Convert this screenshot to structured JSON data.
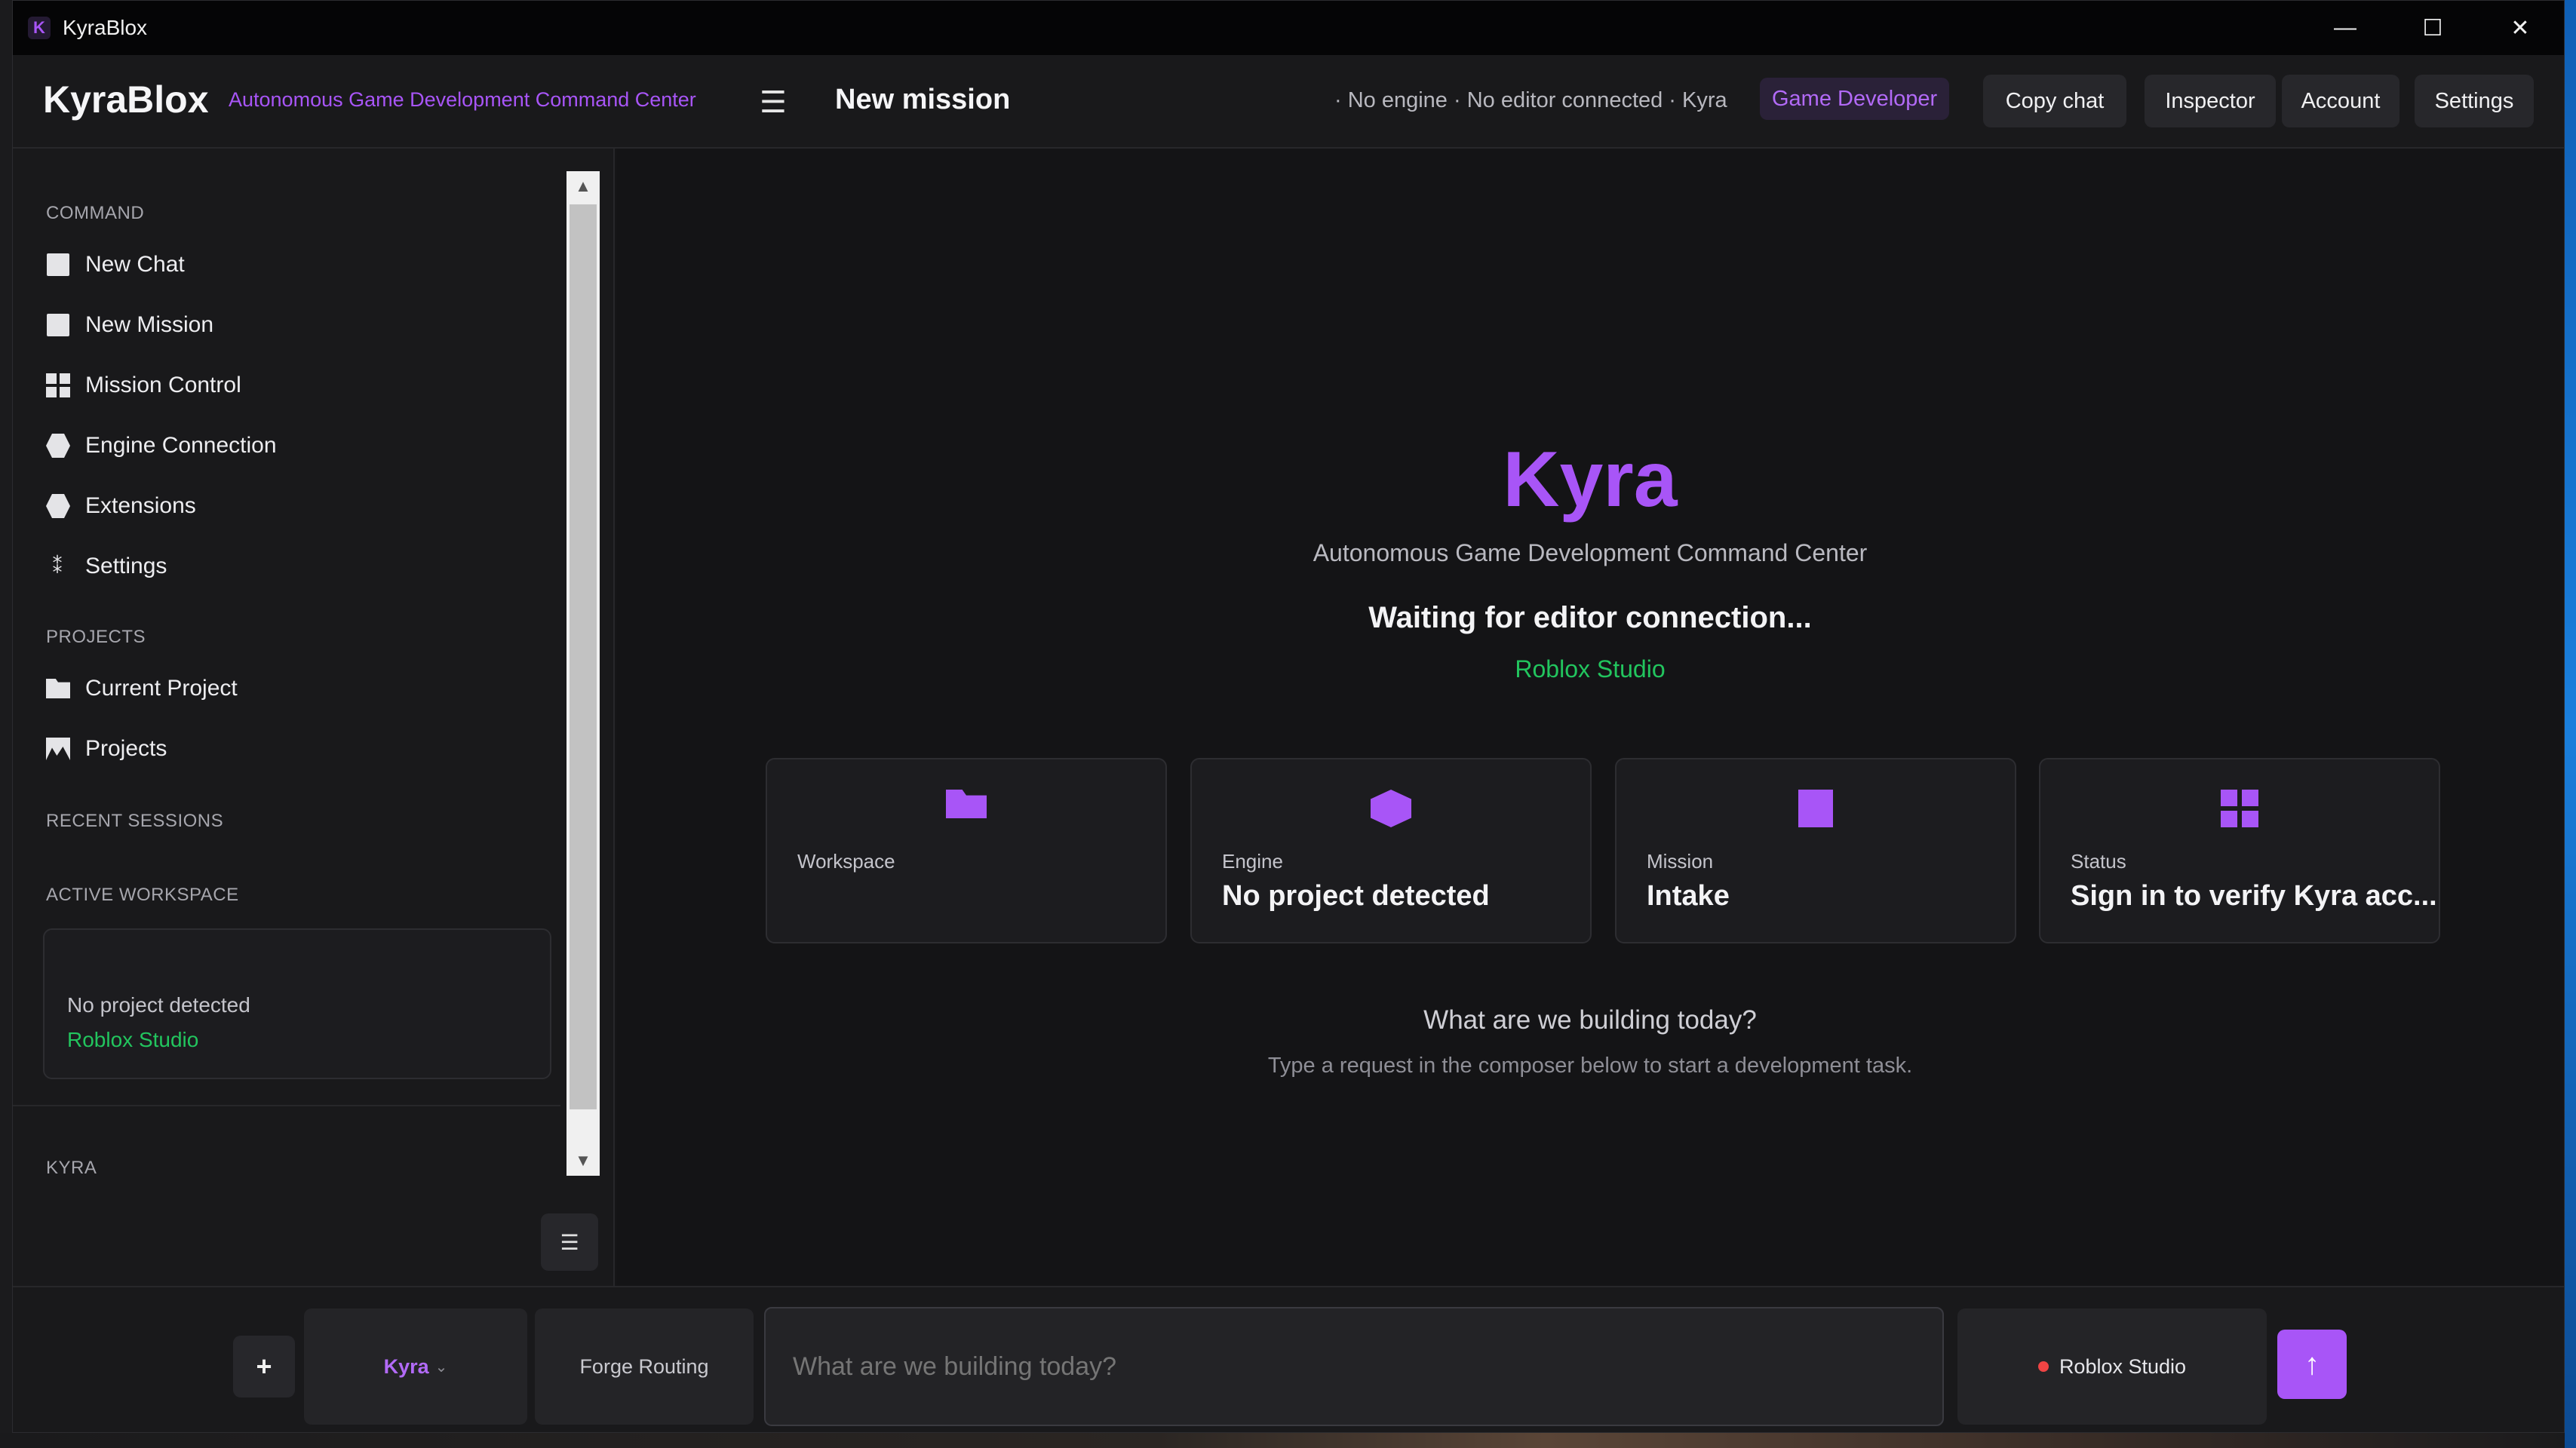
{
  "window": {
    "title": "KyraBlox",
    "app_icon": "K"
  },
  "window_controls": {
    "minimize": "—",
    "maximize": "☐",
    "close": "✕"
  },
  "header": {
    "brand": "KyraBlox",
    "subtitle": "Autonomous Game Development Command Center",
    "page_title": "New mission",
    "connection_status": "· No engine · No editor connected · Kyra",
    "role_badge": "Game Developer",
    "buttons": {
      "copy_chat": "Copy chat",
      "inspector": "Inspector",
      "account": "Account",
      "settings": "Settings"
    }
  },
  "sidebar": {
    "command_label": "COMMAND",
    "command_items": [
      {
        "label": "New Chat",
        "icon": "square-icon"
      },
      {
        "label": "New Mission",
        "icon": "square-icon"
      },
      {
        "label": "Mission Control",
        "icon": "grid-icon"
      },
      {
        "label": "Engine Connection",
        "icon": "hexagon-icon"
      },
      {
        "label": "Extensions",
        "icon": "hexagon-icon"
      },
      {
        "label": "Settings",
        "icon": "gear-icon"
      }
    ],
    "projects_label": "PROJECTS",
    "project_items": [
      {
        "label": "Current Project",
        "icon": "folder-icon"
      },
      {
        "label": "Projects",
        "icon": "image-icon"
      }
    ],
    "recent_sessions_label": "RECENT SESSIONS",
    "active_workspace_label": "ACTIVE WORKSPACE",
    "workspace": {
      "project": "No project detected",
      "engine": "Roblox Studio"
    },
    "kyra_label": "KYRA",
    "collapse_icon": "☰"
  },
  "main": {
    "hero_title": "Kyra",
    "hero_subtitle": "Autonomous Game Development Command Center",
    "waiting_text": "Waiting for editor connection...",
    "engine_name": "Roblox Studio",
    "cards": [
      {
        "label": "Workspace",
        "value": "",
        "icon": "folder-icon"
      },
      {
        "label": "Engine",
        "value": "No project detected",
        "icon": "hexagon-icon"
      },
      {
        "label": "Mission",
        "value": "Intake",
        "icon": "square-icon"
      },
      {
        "label": "Status",
        "value": "Sign in to verify Kyra acc...",
        "icon": "grid-icon"
      }
    ],
    "prompt_title": "What are we building today?",
    "prompt_hint": "Type a request in the composer below to start a development task."
  },
  "composer": {
    "plus": "+",
    "model_selector": "Kyra",
    "model_chevron": "⌄",
    "routing": "Forge Routing",
    "placeholder": "What are we building today?",
    "engine_target": "Roblox Studio",
    "send_icon": "↑"
  },
  "colors": {
    "accent": "#a855f7",
    "success": "#22c55e",
    "danger": "#ef4444"
  }
}
